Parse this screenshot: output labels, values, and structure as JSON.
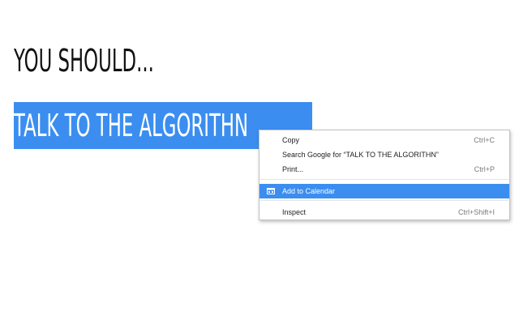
{
  "page": {
    "heading1": "YOU SHOULD...",
    "heading2": "TALK TO THE ALGORITHN"
  },
  "context_menu": {
    "items": [
      {
        "label": "Copy",
        "shortcut": "Ctrl+C"
      },
      {
        "label": "Search Google for “TALK TO THE ALGORITHN”",
        "shortcut": ""
      },
      {
        "label": "Print...",
        "shortcut": "Ctrl+P"
      },
      {
        "label": "Add to Calendar",
        "shortcut": "",
        "icon": "calendar-icon"
      },
      {
        "label": "Inspect",
        "shortcut": "Ctrl+Shift+I"
      }
    ]
  },
  "colors": {
    "selection": "#3b8ef0",
    "heading_text": "#111111"
  }
}
